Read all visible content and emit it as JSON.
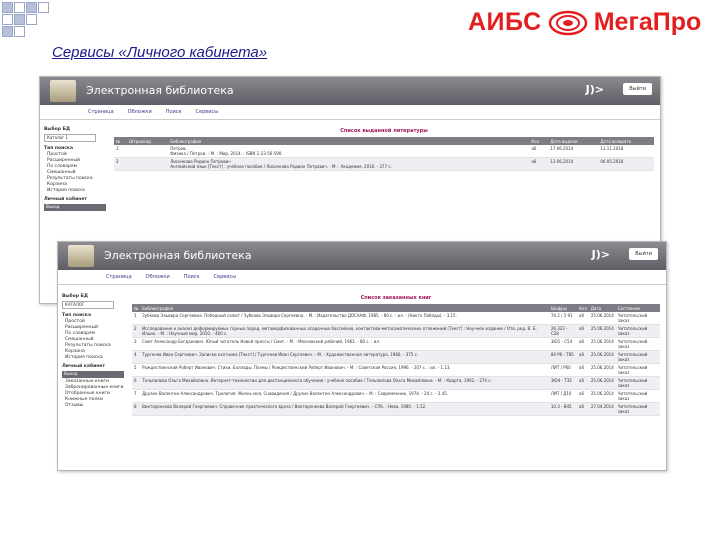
{
  "slide": {
    "title": "Сервисы «Личного кабинета»",
    "brand_left": "АИБС",
    "brand_right": "МегаПро",
    "accent_color": "#e21e1e",
    "title_color": "#1a1a8a"
  },
  "app": {
    "title": "Электронная библиотека",
    "logout": "Выйти"
  },
  "shot1": {
    "nav": [
      "Страница",
      "Обложки",
      "Поиск",
      "Сервисы"
    ],
    "side": {
      "catalog_heading": "Выбор БД",
      "catalog_value": "Каталог 1",
      "search_heading": "Тип поиска",
      "search_items": [
        "Простой",
        "Расширенный",
        "По словарям",
        "Смешанный",
        "Результаты поиска",
        "Корзина",
        "История поиска"
      ],
      "cabinet_heading": "Личный кабинет",
      "cabinet_bar": "Выход"
    },
    "caption": "Список выданной литературы",
    "headers": [
      "№",
      "Штрихкод",
      "Библиография",
      "Кол",
      "Дата выдачи",
      "Дата возврата"
    ],
    "rows": [
      {
        "num": "1",
        "code": "",
        "biblio_author": "Петров,",
        "biblio_text": "Физика / Петров. – М. : Мир, 2014. - ISBN 1-23-56-590",
        "qty": "a6",
        "issued": "17.06.2014",
        "due": "13.11.2018"
      },
      {
        "num": "2",
        "code": "",
        "biblio_author": "Лисичкова Родион Петрович",
        "biblio_text": "Английский язык [Текст] : учебное пособие / Лисичкова Родион Петрович. - М. : Академия, 2010. - 377 с.",
        "qty": "a6",
        "issued": "13.06.2014",
        "due": "06.05.2018"
      }
    ]
  },
  "shot2": {
    "nav": [
      "Страница",
      "Обложки",
      "Поиск",
      "Сервисы"
    ],
    "side": {
      "catalog_heading": "Выбор БД",
      "catalog_value": "КАТАЛОГ",
      "search_heading": "Тип поиска",
      "search_items": [
        "Простой",
        "Расширенный",
        "По словарям",
        "Смешанный",
        "Результаты поиска",
        "Корзина",
        "История поиска"
      ],
      "cabinet_heading": "Личный кабинет",
      "cabinet_bar": "Выход",
      "cabinet_items": [
        "Заказанные книги",
        "Забронированные книги",
        "Отобранные книги",
        "Книжные полки",
        "Отзывы"
      ]
    },
    "caption": "Список заказанных книг",
    "headers": [
      "№",
      "Библиография",
      "Шифры",
      "Кол",
      "Дата",
      "Состояние"
    ],
    "rows": [
      {
        "num": "1",
        "text": "Зубкова Эльвира Сергеевна. Победный салют / Зубкова Эльвира Сергеевна. - М. : Издательство ДОСААФ, 1985. - 80 с. : ил. - (Никто Победы). - 3.15.",
        "code": "74.2 / З 91",
        "qty": "a6",
        "date": "25.06.2014",
        "status": "Читательский заказ"
      },
      {
        "num": "2",
        "text": "Исследование и анализ деформируемых горных пород, метаморфизованных осадочных бассейнов, контактово-метасоматических отложений [Текст] : Научное издание / Отв. ред. В. Б. Ильин. - М. : Научный мир, 2010. - 400 с.",
        "code": "26.323 - С28",
        "qty": "a6",
        "date": "25.06.2014",
        "status": "Читательский заказ"
      },
      {
        "num": "3",
        "text": "Смит Александр Богданович. Юный читатель Новой прессы / Смит. - М. : Московский рабочий, 1962. - 80 с. : ил.",
        "code": "3Ю1 - С54",
        "qty": "a6",
        "date": "25.06.2014",
        "status": "Читательский заказ"
      },
      {
        "num": "4",
        "text": "Тургенев Иван Сергеевич. Записки охотника [Текст] / Тургенев Иван Сергеевич. - М. : Художественная литература, 1966. - 375 с.",
        "code": "84 Р6 - Т85",
        "qty": "a6",
        "date": "25.06.2014",
        "status": "Читательский заказ"
      },
      {
        "num": "5",
        "text": "Рождественский Роберт Иванович. Стихи. Баллады. Поэмы / Рождественский Роберт Иванович. - М. : Советская Россия, 1996. - 207 с. : ил. - 1.13.",
        "code": "ЛИТ / Р60",
        "qty": "a6",
        "date": "25.06.2014",
        "status": "Читательский заказ"
      },
      {
        "num": "6",
        "text": "Тельпилова Ольга Михайловна. Интернет-технологии для дистанционного обучения : учебное пособие / Тельпилова Ольга Михайловна. - М. : Кварта, 1902. - 274 с.",
        "code": "3Ю4 - Т35",
        "qty": "a6",
        "date": "25.06.2014",
        "status": "Читательский заказ"
      },
      {
        "num": "7",
        "text": "Друзин Валентин Александрович. Трилогия: Жизнь моя, Сновидения / Друзин Валентин Александрович. - М. : Современник, 1974. - 24 с. - 2.45.",
        "code": "ЛИТ / Д10",
        "qty": "a6",
        "date": "25.06.2014",
        "status": "Читательский заказ"
      },
      {
        "num": "8",
        "text": "Викторенкова Валерий Георгиевич. Справочник практического врача / Викторенкова Валерий Георгиевич. - СПб. : Нева, 1980. - 1.52.",
        "code": "10.3 - В45",
        "qty": "a6",
        "date": "27.04.2014",
        "status": "Читательский заказ"
      }
    ]
  }
}
